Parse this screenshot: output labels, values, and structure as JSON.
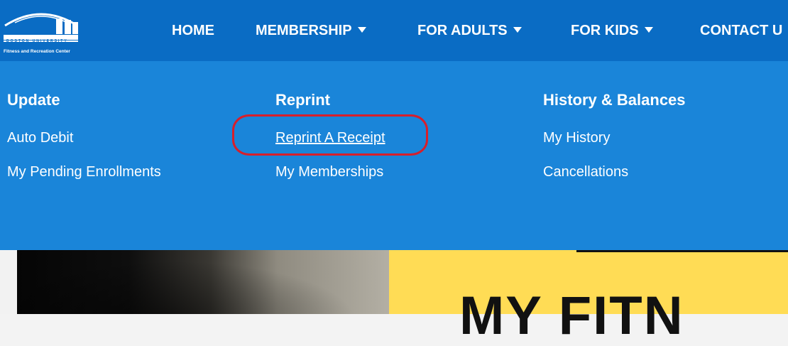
{
  "logo": {
    "icon": "bu-fitness-logo-icon",
    "wordmark": "BOSTON UNIVERSITY",
    "caption": "Fitness and Recreation Center"
  },
  "nav": {
    "items": [
      {
        "label": "HOME",
        "has_dropdown": false
      },
      {
        "label": "MEMBERSHIP",
        "has_dropdown": true
      },
      {
        "label": "FOR ADULTS",
        "has_dropdown": true
      },
      {
        "label": "FOR KIDS",
        "has_dropdown": true
      },
      {
        "label": "CONTACT U",
        "has_dropdown": false
      }
    ],
    "caret_icon": "caret-down-icon"
  },
  "dropdown": {
    "columns": [
      {
        "heading": "Update",
        "links": [
          "Auto Debit",
          "My Pending Enrollments"
        ]
      },
      {
        "heading": "Reprint",
        "links": [
          "Reprint A Receipt",
          "My Memberships"
        ]
      },
      {
        "heading": "History & Balances",
        "links": [
          "My History",
          "Cancellations"
        ]
      }
    ],
    "highlighted_link": "Reprint A Receipt"
  },
  "hero": {
    "headline": "MY FITN"
  },
  "colors": {
    "nav_bg": "#0a6cc4",
    "dropdown_bg": "#1a85d9",
    "highlight_ring": "#d71f2b",
    "promo_bg": "#ffdc55"
  }
}
